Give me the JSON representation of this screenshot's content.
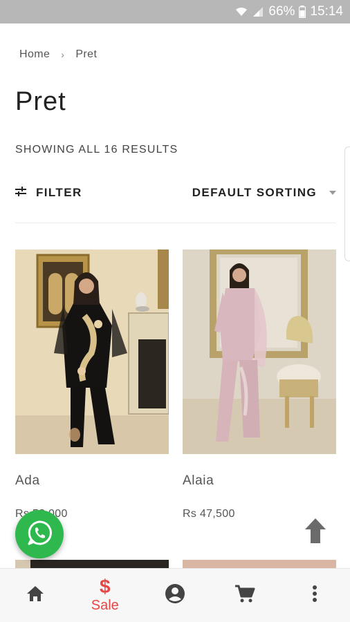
{
  "status_bar": {
    "battery": "66%",
    "time": "15:14"
  },
  "breadcrumb": {
    "home": "Home",
    "separator": "›",
    "current": "Pret"
  },
  "page": {
    "title": "Pret",
    "result_count": "SHOWING ALL 16 RESULTS"
  },
  "toolbar": {
    "filter_label": "FILTER",
    "sort_label": "DEFAULT SORTING"
  },
  "products": [
    {
      "name": "Ada",
      "price": "Rs 58,000"
    },
    {
      "name": "Alaia",
      "price": "Rs 47,500"
    }
  ],
  "bottom_nav": {
    "sale_icon": "$",
    "sale_label": "Sale"
  },
  "colors": {
    "accent": "#e84545",
    "whatsapp": "#2fb84e",
    "status_bar": "#b7b7b7"
  }
}
